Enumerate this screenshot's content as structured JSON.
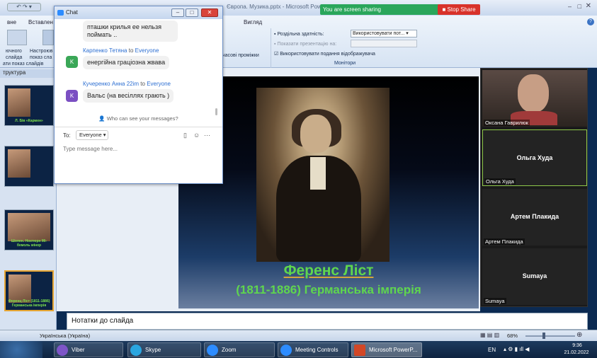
{
  "powerpoint": {
    "title": "Європа. Музика.pptx - Microsoft PowerPoint",
    "tabs": [
      "вне",
      "Вставлен",
      "Вигляд"
    ],
    "ribbon": {
      "btn_slide_label": "ючного слайда",
      "btn_setup_label": "Настроюв показ сла",
      "timings_label": "часові проміжки",
      "resolution_label": "Роздільна здатність:",
      "resolution_value": "Використовувати пот...",
      "show_on_label": "Показати презентацію на:",
      "show_on_value": "",
      "presenter_view_label": "Використовувати подання відображувача",
      "group_caption": "Монітори",
      "left_caption": "ати показ слайдів"
    },
    "outline_tab": "труктура",
    "thumbs": [
      {
        "caption": "Л. Бів «Кармен»"
      },
      {
        "caption": ""
      },
      {
        "caption": "Шопен. Ноктюрн Мі-бемоль мінор"
      },
      {
        "caption": "Ференц Ліст (1811-1886) Германська імперія"
      }
    ],
    "slide": {
      "title": "Ференс Ліст",
      "subtitle": "(1811-1886) Германська імперія"
    },
    "notes_placeholder": "Нотатки до слайда",
    "status": {
      "language": "Українська (Україна)",
      "zoom": "68%"
    }
  },
  "zoom_bar": {
    "sharing_text": "You are screen sharing",
    "stop_share": "Stop Share"
  },
  "chat": {
    "title": "Chat",
    "messages": [
      {
        "sender": "",
        "to": "",
        "text": "пташки крилья ее нельзя поймать ..",
        "initial": ""
      },
      {
        "sender": "Карпенко Тетяна",
        "to_word": "to",
        "to": "Everyone",
        "text": "енергійна граціозна жвава",
        "initial": "K",
        "color": "#3aa757"
      },
      {
        "sender": "Кучеренко Анна 22im",
        "to_word": "to",
        "to": "Everyone",
        "text": "Вальс (на весіллях грають )",
        "initial": "K",
        "color": "#7b4fc2"
      }
    ],
    "who_can_see": "Who can see your messages?",
    "to_label": "To:",
    "to_value": "Everyone",
    "input_placeholder": "Type message here..."
  },
  "participants": [
    {
      "name": "Оксана Гаврилюк",
      "display": "",
      "video": true
    },
    {
      "name": "Ольга Худа",
      "display": "Ольга Худа",
      "video": false
    },
    {
      "name": "Артем Плакида",
      "display": "Артем Плакида",
      "video": false
    },
    {
      "name": "Sumaya",
      "display": "Sumaya",
      "video": false
    }
  ],
  "taskbar": {
    "items": [
      "Viber",
      "Skype",
      "Zoom",
      "Meeting Controls",
      "Microsoft PowerP..."
    ],
    "lang": "EN",
    "time": "9:36",
    "date": "21.02.2022"
  }
}
